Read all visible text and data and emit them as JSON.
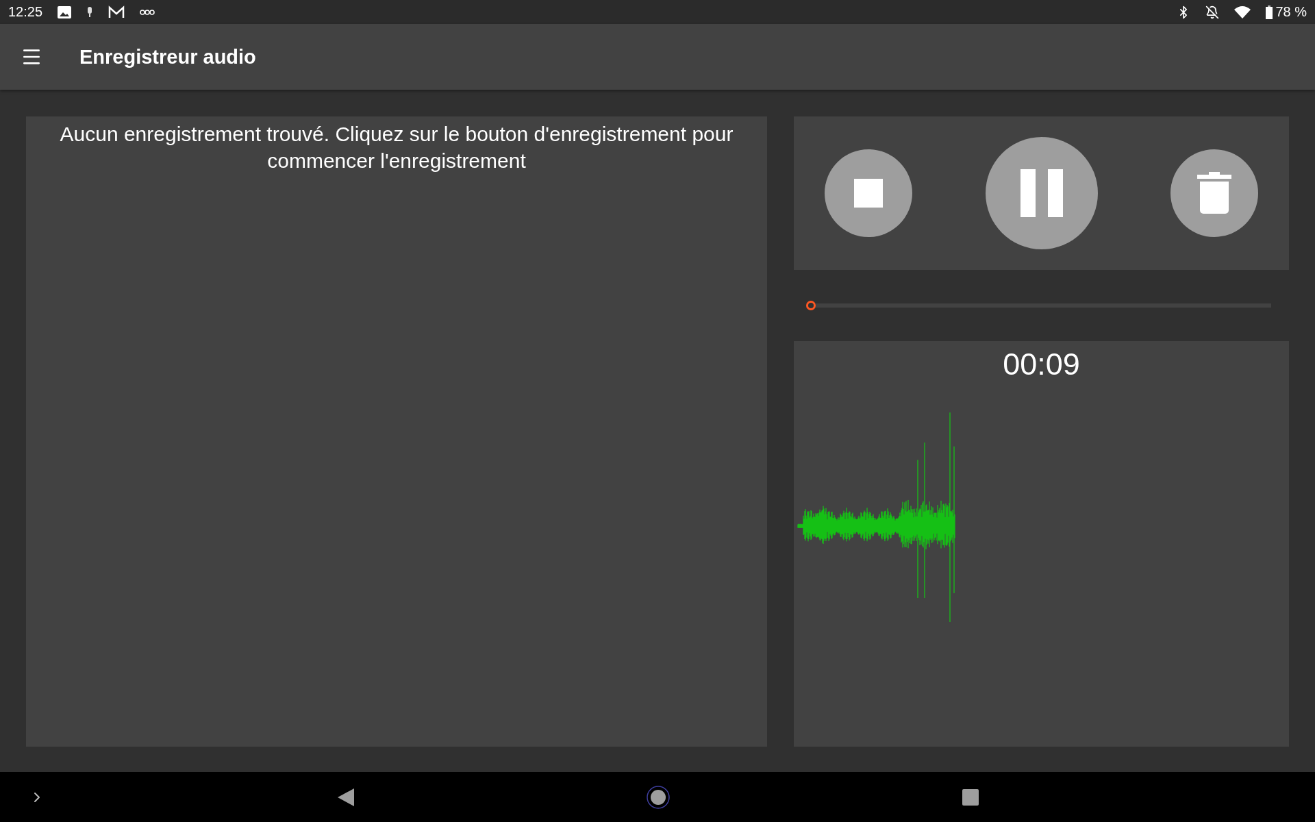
{
  "status_bar": {
    "time": "12:25",
    "battery": "78 %"
  },
  "app_bar": {
    "title": "Enregistreur audio"
  },
  "recordings": {
    "empty_message": "Aucun enregistrement trouvé. Cliquez sur le bouton d'enregistrement pour commencer l'enregistrement"
  },
  "recorder": {
    "recording": true,
    "progress": {
      "level": 0
    },
    "timer": "00:09"
  }
}
